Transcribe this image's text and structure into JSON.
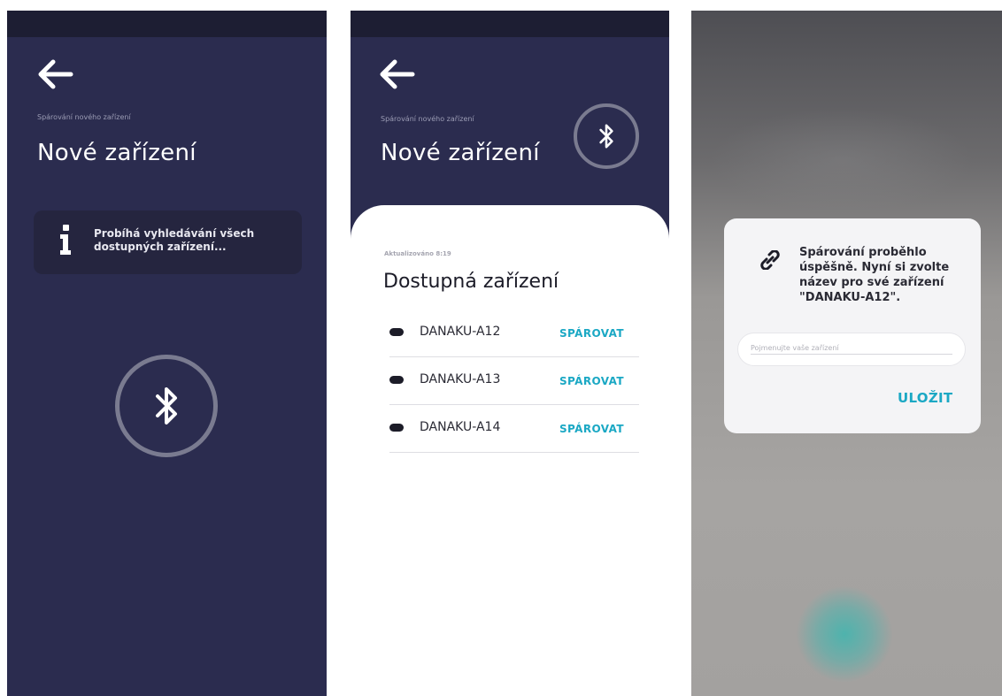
{
  "screen1": {
    "subtitle": "Spárování nového zařízení",
    "title": "Nové zařízení",
    "info_text": "Probíhá vyhledávání všech dostupných zařízení...",
    "icons": [
      "back-arrow-icon",
      "info-icon",
      "bluetooth-icon"
    ]
  },
  "screen2": {
    "subtitle": "Spárování nového zařízení",
    "title": "Nové zařízení",
    "updated": "Aktualizováno 8:19",
    "list_title": "Dostupná zařízení",
    "devices": [
      {
        "name": "DANAKU-A12",
        "action": "SPÁROVAT"
      },
      {
        "name": "DANAKU-A13",
        "action": "SPÁROVAT"
      },
      {
        "name": "DANAKU-A14",
        "action": "SPÁROVAT"
      }
    ]
  },
  "screen3": {
    "message": "Spárování proběhlo úspěšně. Nyní si zvolte název pro své zařízení \"DANAKU-A12\".",
    "input_placeholder": "Pojmenujte vaše zařízení",
    "input_value": "",
    "save_label": "ULOŽIT",
    "icons": [
      "link-icon"
    ]
  },
  "colors": {
    "header_bg": "#2b2c4f",
    "status_bar": "#1d1e33",
    "accent": "#1ba8c4",
    "ring": "#7a7b90"
  }
}
